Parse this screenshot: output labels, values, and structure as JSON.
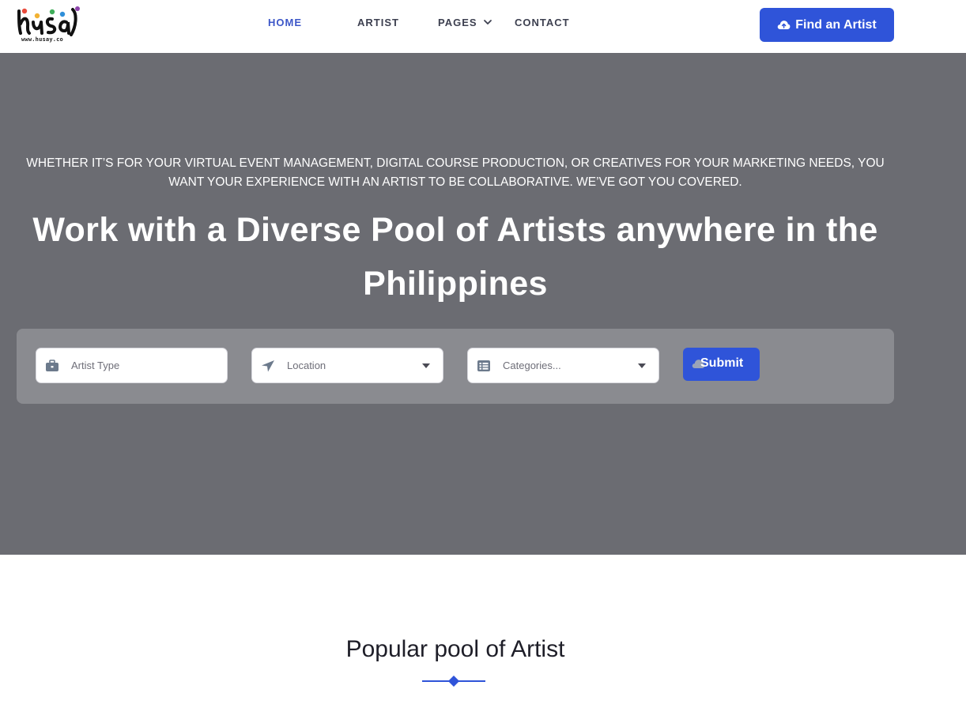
{
  "header": {
    "logo_text": "husay",
    "logo_url": "www.husay.co",
    "nav": [
      {
        "label": "HOME",
        "active": true
      },
      {
        "label": "ARTIST",
        "active": false
      },
      {
        "label": "PAGES",
        "active": false,
        "dropdown": true
      },
      {
        "label": "CONTACT",
        "active": false
      }
    ],
    "cta_label": "Find an Artist",
    "cta_icon": "cloud-upload-icon"
  },
  "hero": {
    "lead": "WHETHER IT’S FOR YOUR VIRTUAL EVENT MANAGEMENT, DIGITAL COURSE PRODUCTION, OR CREATIVES FOR YOUR MARKETING NEEDS, YOU WANT YOUR EXPERIENCE WITH AN ARTIST TO BE COLLABORATIVE. WE’VE GOT YOU COVERED.",
    "title": "Work with a Diverse Pool of Artists anywhere in the Philippines",
    "search": {
      "artist_type_placeholder": "Artist Type",
      "location_selected": "Location",
      "categories_selected": "Categories...",
      "submit_label": "Submit"
    }
  },
  "popular": {
    "title": "Popular pool of Artist"
  },
  "colors": {
    "accent": "#2f54d9",
    "hero_bg": "#6b6c72",
    "panel_bg": "#8a8b90",
    "nav_active": "#3d57c8"
  }
}
